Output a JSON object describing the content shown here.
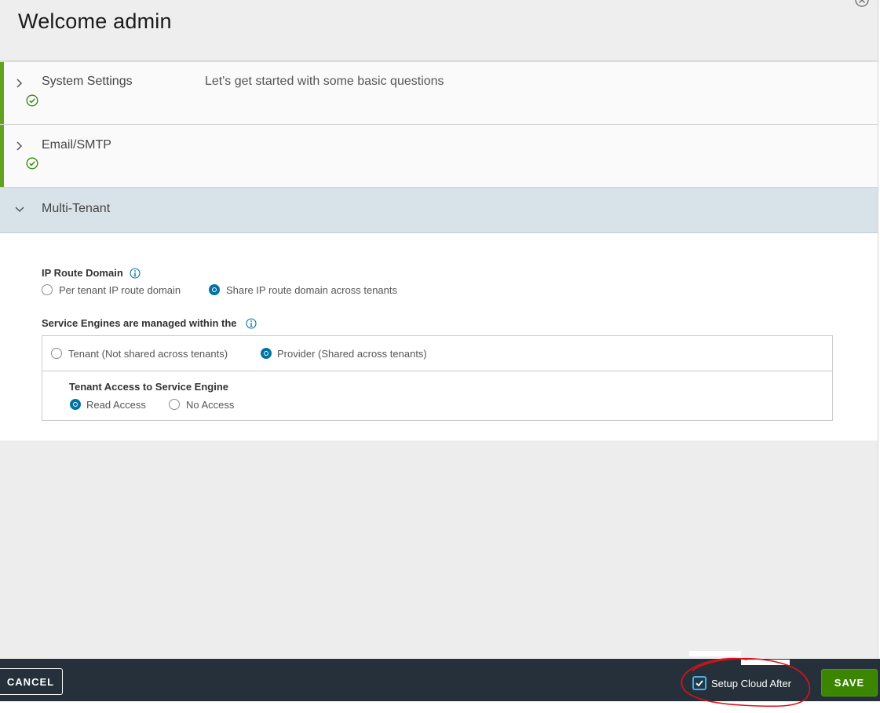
{
  "header": {
    "title": "Welcome admin"
  },
  "sections": [
    {
      "title": "System Settings",
      "description": "Let's get started with some basic questions",
      "state": "completed"
    },
    {
      "title": "Email/SMTP",
      "state": "completed"
    },
    {
      "title": "Multi-Tenant",
      "state": "expanded"
    }
  ],
  "multi_tenant": {
    "ip_route_domain": {
      "label": "IP Route Domain",
      "options": [
        "Per tenant IP route domain",
        "Share IP route domain across tenants"
      ],
      "selected": "Share IP route domain across tenants"
    },
    "service_engines": {
      "label": "Service Engines are managed within the",
      "options": [
        "Tenant (Not shared across tenants)",
        "Provider (Shared across tenants)"
      ],
      "selected": "Provider (Shared across tenants)"
    },
    "tenant_access": {
      "label": "Tenant Access to Service Engine",
      "options": [
        "Read Access",
        "No Access"
      ],
      "selected": "Read Access"
    }
  },
  "footer": {
    "cancel_label": "CANCEL",
    "setup_cloud_label": "Setup Cloud After",
    "setup_cloud_checked": true,
    "save_label": "SAVE"
  },
  "colors": {
    "accent": "#0072a3",
    "success": "#62a420",
    "save_button": "#3c8500",
    "footer_bg": "#25303b",
    "annotation": "#e0101a"
  }
}
